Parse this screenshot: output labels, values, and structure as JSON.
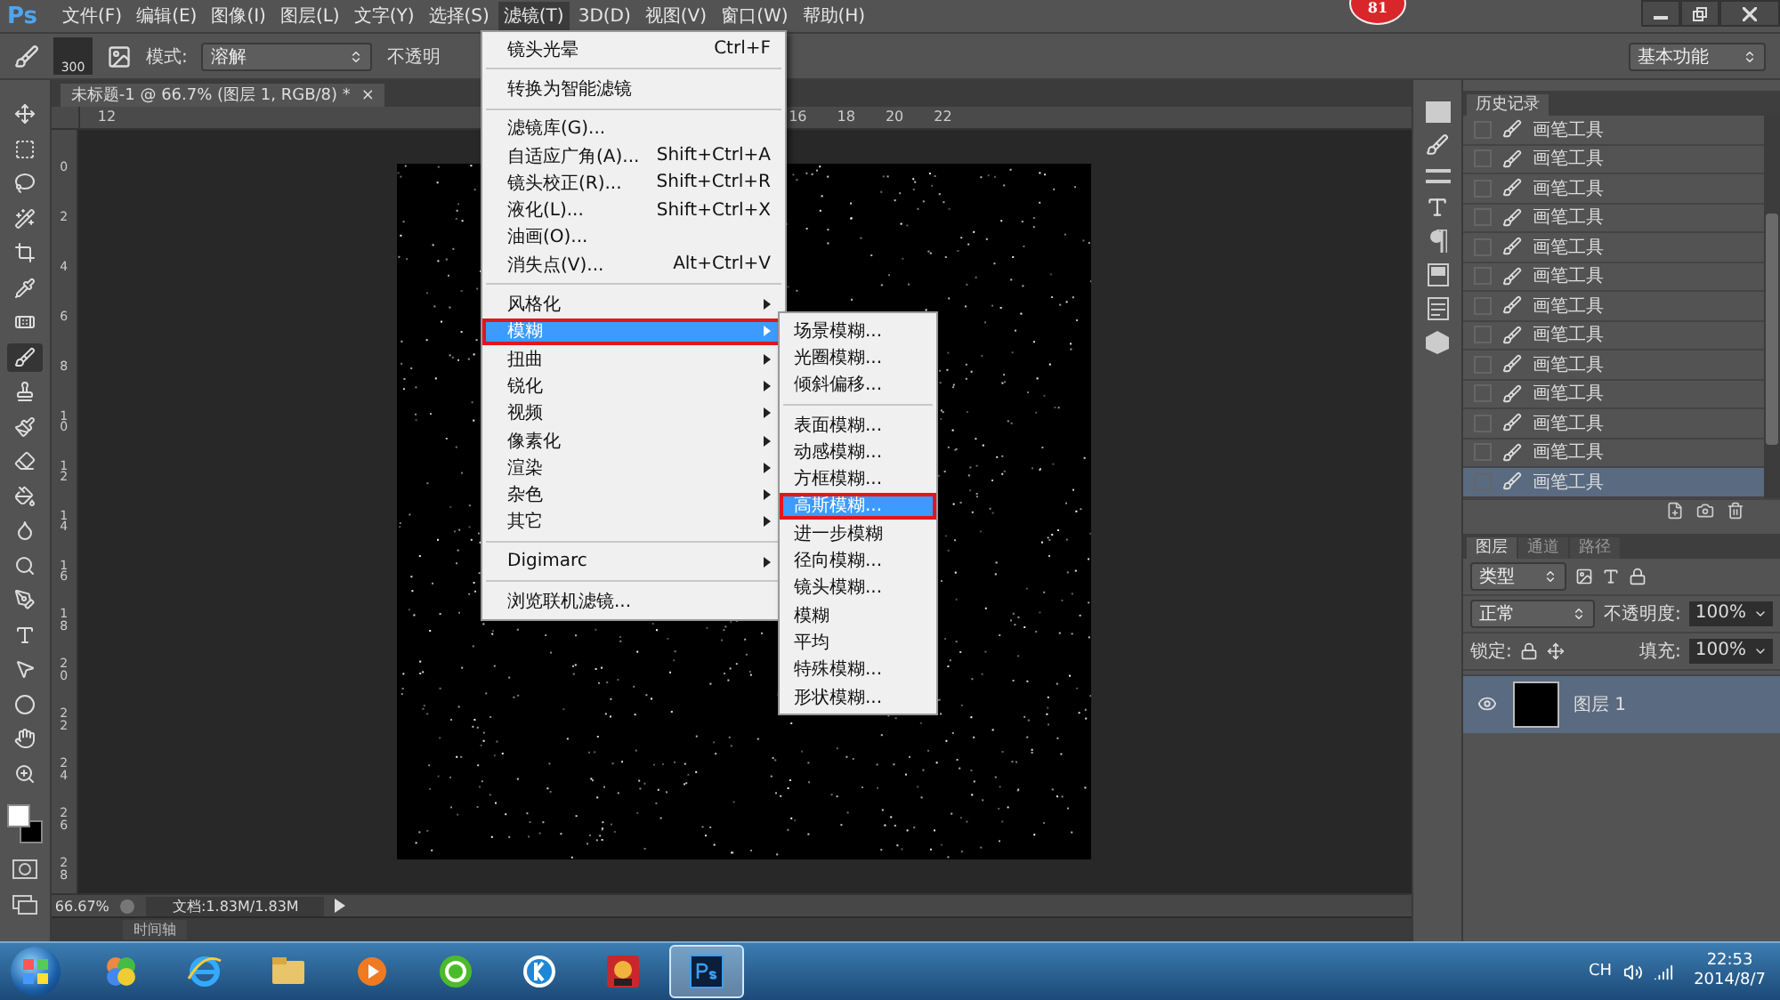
{
  "app_logo": "Ps",
  "menu_bar": [
    {
      "label": "文件(F)",
      "selected": false
    },
    {
      "label": "编辑(E)",
      "selected": false
    },
    {
      "label": "图像(I)",
      "selected": false
    },
    {
      "label": "图层(L)",
      "selected": false
    },
    {
      "label": "文字(Y)",
      "selected": false
    },
    {
      "label": "选择(S)",
      "selected": false
    },
    {
      "label": "滤镜(T)",
      "selected": true
    },
    {
      "label": "3D(D)",
      "selected": false
    },
    {
      "label": "视图(V)",
      "selected": false
    },
    {
      "label": "窗口(W)",
      "selected": false
    },
    {
      "label": "帮助(H)",
      "selected": false
    }
  ],
  "badge": "81",
  "options_bar": {
    "brush_size": "300",
    "mode_label": "模式:",
    "mode_value": "溶解",
    "opacity_label": "不透明",
    "workspace": "基本功能"
  },
  "document_tab": {
    "title": "未标题-1 @ 66.7% (图层 1, RGB/8) *",
    "close": "×"
  },
  "top_ruler": [
    "12",
    "16",
    "18",
    "20",
    "22"
  ],
  "left_ruler": [
    "0",
    "2",
    "4",
    "6",
    "8",
    "10",
    "12",
    "14",
    "16",
    "18",
    "20",
    "22",
    "24",
    "26",
    "28"
  ],
  "tools": [
    {
      "kind": "move",
      "selected": false
    },
    {
      "kind": "marquee",
      "selected": false
    },
    {
      "kind": "lasso",
      "selected": false
    },
    {
      "kind": "quick-select",
      "selected": false
    },
    {
      "kind": "crop",
      "selected": false
    },
    {
      "kind": "eyedropper",
      "selected": false
    },
    {
      "kind": "healing",
      "selected": false
    },
    {
      "kind": "brush",
      "selected": true
    },
    {
      "kind": "stamp",
      "selected": false
    },
    {
      "kind": "history-brush",
      "selected": false
    },
    {
      "kind": "eraser",
      "selected": false
    },
    {
      "kind": "bucket",
      "selected": false
    },
    {
      "kind": "blur",
      "selected": false
    },
    {
      "kind": "dodge",
      "selected": false
    },
    {
      "kind": "pen",
      "selected": false
    },
    {
      "kind": "type",
      "selected": false
    },
    {
      "kind": "path-select",
      "selected": false
    },
    {
      "kind": "ellipse",
      "selected": false
    },
    {
      "kind": "hand",
      "selected": false
    },
    {
      "kind": "zoom",
      "selected": false
    }
  ],
  "status_bar": {
    "zoom": "66.67%",
    "doc_info": "文档:1.83M/1.83M"
  },
  "timeline_tab": "时间轴",
  "filter_menu": {
    "groups": [
      {
        "items": [
          {
            "label": "镜头光晕",
            "shortcut": "Ctrl+F",
            "submenu": false,
            "selected": false,
            "marked": false
          }
        ]
      },
      {
        "items": [
          {
            "label": "转换为智能滤镜",
            "submenu": false,
            "selected": false,
            "marked": false
          }
        ]
      },
      {
        "items": [
          {
            "label": "滤镜库(G)...",
            "submenu": false,
            "selected": false,
            "marked": false
          },
          {
            "label": "自适应广角(A)...",
            "shortcut": "Shift+Ctrl+A",
            "submenu": false,
            "selected": false,
            "marked": false
          },
          {
            "label": "镜头校正(R)...",
            "shortcut": "Shift+Ctrl+R",
            "submenu": false,
            "selected": false,
            "marked": false
          },
          {
            "label": "液化(L)...",
            "shortcut": "Shift+Ctrl+X",
            "submenu": false,
            "selected": false,
            "marked": false
          },
          {
            "label": "油画(O)...",
            "submenu": false,
            "selected": false,
            "marked": false
          },
          {
            "label": "消失点(V)...",
            "shortcut": "Alt+Ctrl+V",
            "submenu": false,
            "selected": false,
            "marked": false
          }
        ]
      },
      {
        "items": [
          {
            "label": "风格化",
            "submenu": true,
            "selected": false,
            "marked": false
          },
          {
            "label": "模糊",
            "submenu": true,
            "selected": true,
            "marked": true
          },
          {
            "label": "扭曲",
            "submenu": true,
            "selected": false,
            "marked": false
          },
          {
            "label": "锐化",
            "submenu": true,
            "selected": false,
            "marked": false
          },
          {
            "label": "视频",
            "submenu": true,
            "selected": false,
            "marked": false
          },
          {
            "label": "像素化",
            "submenu": true,
            "selected": false,
            "marked": false
          },
          {
            "label": "渲染",
            "submenu": true,
            "selected": false,
            "marked": false
          },
          {
            "label": "杂色",
            "submenu": true,
            "selected": false,
            "marked": false
          },
          {
            "label": "其它",
            "submenu": true,
            "selected": false,
            "marked": false
          }
        ]
      },
      {
        "items": [
          {
            "label": "Digimarc",
            "submenu": true,
            "selected": false,
            "marked": false
          }
        ]
      },
      {
        "items": [
          {
            "label": "浏览联机滤镜...",
            "submenu": false,
            "selected": false,
            "marked": false
          }
        ]
      }
    ]
  },
  "blur_submenu": {
    "groups": [
      {
        "items": [
          {
            "label": "场景模糊...",
            "selected": false,
            "marked": false
          },
          {
            "label": "光圈模糊...",
            "selected": false,
            "marked": false
          },
          {
            "label": "倾斜偏移...",
            "selected": false,
            "marked": false
          }
        ]
      },
      {
        "items": [
          {
            "label": "表面模糊...",
            "selected": false,
            "marked": false
          },
          {
            "label": "动感模糊...",
            "selected": false,
            "marked": false
          },
          {
            "label": "方框模糊...",
            "selected": false,
            "marked": false
          },
          {
            "label": "高斯模糊...",
            "selected": true,
            "marked": true
          },
          {
            "label": "进一步模糊",
            "selected": false,
            "marked": false
          },
          {
            "label": "径向模糊...",
            "selected": false,
            "marked": false
          },
          {
            "label": "镜头模糊...",
            "selected": false,
            "marked": false
          },
          {
            "label": "模糊",
            "selected": false,
            "marked": false
          },
          {
            "label": "平均",
            "selected": false,
            "marked": false
          },
          {
            "label": "特殊模糊...",
            "selected": false,
            "marked": false
          },
          {
            "label": "形状模糊...",
            "selected": false,
            "marked": false
          }
        ]
      }
    ]
  },
  "history_panel": {
    "title": "历史记录",
    "rows": [
      {
        "label": "画笔工具",
        "selected": false
      },
      {
        "label": "画笔工具",
        "selected": false
      },
      {
        "label": "画笔工具",
        "selected": false
      },
      {
        "label": "画笔工具",
        "selected": false
      },
      {
        "label": "画笔工具",
        "selected": false
      },
      {
        "label": "画笔工具",
        "selected": false
      },
      {
        "label": "画笔工具",
        "selected": false
      },
      {
        "label": "画笔工具",
        "selected": false
      },
      {
        "label": "画笔工具",
        "selected": false
      },
      {
        "label": "画笔工具",
        "selected": false
      },
      {
        "label": "画笔工具",
        "selected": false
      },
      {
        "label": "画笔工具",
        "selected": false
      },
      {
        "label": "画笔工具",
        "selected": true
      }
    ]
  },
  "layers_panel": {
    "tabs": [
      {
        "label": "图层",
        "selected": true
      },
      {
        "label": "通道",
        "selected": false
      },
      {
        "label": "路径",
        "selected": false
      }
    ],
    "filter": "类型",
    "blend_mode": "正常",
    "opacity_label": "不透明度:",
    "opacity": "100%",
    "lock_label": "锁定:",
    "fill_label": "填充:",
    "fill": "100%",
    "layers": [
      {
        "name": "图层 1",
        "selected": true,
        "visible": true
      }
    ]
  },
  "taskbar": {
    "apps": [
      {
        "kind": "balls",
        "active": false
      },
      {
        "kind": "ie",
        "active": false
      },
      {
        "kind": "folder",
        "active": false
      },
      {
        "kind": "player",
        "active": false
      },
      {
        "kind": "green-browser",
        "active": false
      },
      {
        "kind": "k-app",
        "active": false
      },
      {
        "kind": "game",
        "active": false
      },
      {
        "kind": "photoshop",
        "active": true
      }
    ],
    "language": "CH",
    "time": "22:53",
    "date": "2014/8/7"
  }
}
